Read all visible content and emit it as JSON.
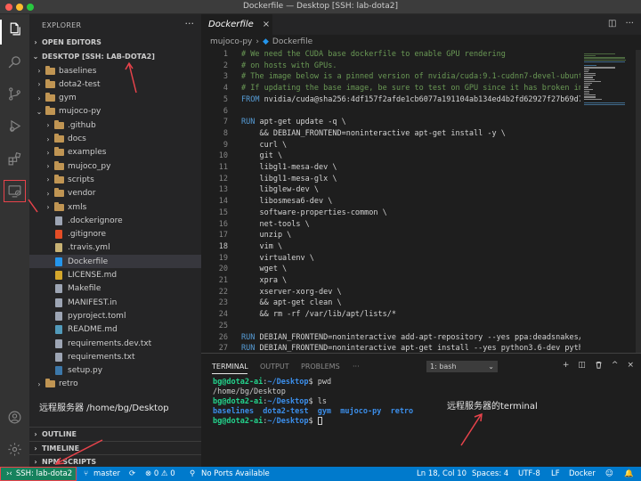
{
  "window": {
    "title": "Dockerfile — Desktop [SSH: lab-dota2]"
  },
  "explorer": {
    "header": "EXPLORER",
    "more": "···",
    "sections": {
      "open_editors": "OPEN EDITORS",
      "workspace": "DESKTOP [SSH: LAB-DOTA2]",
      "outline": "OUTLINE",
      "timeline": "TIMELINE",
      "npm_scripts": "NPM SCRIPTS"
    },
    "items": [
      {
        "label": "baselines",
        "kind": "folder",
        "depth": 1,
        "chevron": "›"
      },
      {
        "label": "dota2-test",
        "kind": "folder",
        "depth": 1,
        "chevron": "›"
      },
      {
        "label": "gym",
        "kind": "folder",
        "depth": 1,
        "chevron": "›"
      },
      {
        "label": "mujoco-py",
        "kind": "folder",
        "depth": 1,
        "chevron": "⌄"
      },
      {
        "label": ".github",
        "kind": "folder",
        "depth": 2,
        "chevron": "›"
      },
      {
        "label": "docs",
        "kind": "folder",
        "depth": 2,
        "chevron": "›"
      },
      {
        "label": "examples",
        "kind": "folder",
        "depth": 2,
        "chevron": "›"
      },
      {
        "label": "mujoco_py",
        "kind": "folder",
        "depth": 2,
        "chevron": "›"
      },
      {
        "label": "scripts",
        "kind": "folder",
        "depth": 2,
        "chevron": "›"
      },
      {
        "label": "vendor",
        "kind": "folder",
        "depth": 2,
        "chevron": "›"
      },
      {
        "label": "xmls",
        "kind": "folder",
        "depth": 2,
        "chevron": "›"
      },
      {
        "label": ".dockerignore",
        "kind": "file",
        "depth": 2,
        "color": "#9da5b4"
      },
      {
        "label": ".gitignore",
        "kind": "file",
        "depth": 2,
        "color": "#e44d26"
      },
      {
        "label": ".travis.yml",
        "kind": "file",
        "depth": 2,
        "color": "#c8b274"
      },
      {
        "label": "Dockerfile",
        "kind": "file",
        "depth": 2,
        "color": "#2496ed",
        "selected": true
      },
      {
        "label": "LICENSE.md",
        "kind": "file",
        "depth": 2,
        "color": "#d4a72c"
      },
      {
        "label": "Makefile",
        "kind": "file",
        "depth": 2,
        "color": "#9da5b4"
      },
      {
        "label": "MANIFEST.in",
        "kind": "file",
        "depth": 2,
        "color": "#9da5b4"
      },
      {
        "label": "pyproject.toml",
        "kind": "file",
        "depth": 2,
        "color": "#9da5b4"
      },
      {
        "label": "README.md",
        "kind": "file",
        "depth": 2,
        "color": "#519aba"
      },
      {
        "label": "requirements.dev.txt",
        "kind": "file",
        "depth": 2,
        "color": "#9da5b4"
      },
      {
        "label": "requirements.txt",
        "kind": "file",
        "depth": 2,
        "color": "#9da5b4"
      },
      {
        "label": "setup.py",
        "kind": "file",
        "depth": 2,
        "color": "#3c78aa"
      },
      {
        "label": "retro",
        "kind": "folder",
        "depth": 1,
        "chevron": "›"
      }
    ]
  },
  "annotations": {
    "remote_path": "远程服务器 /home/bg/Desktop",
    "remote_terminal": "远程服务器的terminal"
  },
  "editor": {
    "tab_label": "Dockerfile",
    "tab_close": "×",
    "breadcrumb": {
      "folder": "mujoco-py",
      "file": "Dockerfile",
      "separator": "›"
    },
    "lines": [
      {
        "n": "1",
        "segs": [
          {
            "t": "# We need the CUDA base dockerfile to enable GPU rendering",
            "c": "#6a9955"
          }
        ]
      },
      {
        "n": "2",
        "segs": [
          {
            "t": "# on hosts with GPUs.",
            "c": "#6a9955"
          }
        ]
      },
      {
        "n": "3",
        "segs": [
          {
            "t": "# The image below is a pinned version of nvidia/cuda:9.1-cudnn7-devel-ubuntu1",
            "c": "#6a9955"
          }
        ]
      },
      {
        "n": "4",
        "segs": [
          {
            "t": "# If updating the base image, be sure to test on GPU since it has broken in th",
            "c": "#6a9955"
          }
        ]
      },
      {
        "n": "5",
        "segs": [
          {
            "t": "FROM ",
            "c": "#569cd6"
          },
          {
            "t": "nvidia/cuda@sha256:4df157f2afde1cb6077a191104ab134ed4b2fd62927f27b69d788",
            "c": "#d4d4d4"
          }
        ]
      },
      {
        "n": "6",
        "segs": []
      },
      {
        "n": "7",
        "segs": [
          {
            "t": "RUN ",
            "c": "#569cd6"
          },
          {
            "t": "apt-get update -q \\",
            "c": "#d4d4d4"
          }
        ]
      },
      {
        "n": "8",
        "segs": [
          {
            "t": "    && DEBIAN_FRONTEND=noninteractive apt-get install -y \\",
            "c": "#d4d4d4"
          }
        ]
      },
      {
        "n": "9",
        "segs": [
          {
            "t": "    curl \\",
            "c": "#d4d4d4"
          }
        ]
      },
      {
        "n": "10",
        "segs": [
          {
            "t": "    git \\",
            "c": "#d4d4d4"
          }
        ]
      },
      {
        "n": "11",
        "segs": [
          {
            "t": "    libgl1-mesa-dev \\",
            "c": "#d4d4d4"
          }
        ]
      },
      {
        "n": "12",
        "segs": [
          {
            "t": "    libgl1-mesa-glx \\",
            "c": "#d4d4d4"
          }
        ]
      },
      {
        "n": "13",
        "segs": [
          {
            "t": "    libglew-dev \\",
            "c": "#d4d4d4"
          }
        ]
      },
      {
        "n": "14",
        "segs": [
          {
            "t": "    libosmesa6-dev \\",
            "c": "#d4d4d4"
          }
        ]
      },
      {
        "n": "15",
        "segs": [
          {
            "t": "    software-properties-common \\",
            "c": "#d4d4d4"
          }
        ]
      },
      {
        "n": "16",
        "segs": [
          {
            "t": "    net-tools \\",
            "c": "#d4d4d4"
          }
        ]
      },
      {
        "n": "17",
        "segs": [
          {
            "t": "    unzip \\",
            "c": "#d4d4d4"
          }
        ]
      },
      {
        "n": "18",
        "segs": [
          {
            "t": "    vim \\",
            "c": "#d4d4d4"
          }
        ],
        "current": true
      },
      {
        "n": "19",
        "segs": [
          {
            "t": "    virtualenv \\",
            "c": "#d4d4d4"
          }
        ]
      },
      {
        "n": "20",
        "segs": [
          {
            "t": "    wget \\",
            "c": "#d4d4d4"
          }
        ]
      },
      {
        "n": "21",
        "segs": [
          {
            "t": "    xpra \\",
            "c": "#d4d4d4"
          }
        ]
      },
      {
        "n": "22",
        "segs": [
          {
            "t": "    xserver-xorg-dev \\",
            "c": "#d4d4d4"
          }
        ]
      },
      {
        "n": "23",
        "segs": [
          {
            "t": "    && apt-get clean \\",
            "c": "#d4d4d4"
          }
        ]
      },
      {
        "n": "24",
        "segs": [
          {
            "t": "    && rm -rf /var/lib/apt/lists/*",
            "c": "#d4d4d4"
          }
        ]
      },
      {
        "n": "25",
        "segs": []
      },
      {
        "n": "26",
        "segs": [
          {
            "t": "RUN ",
            "c": "#569cd6"
          },
          {
            "t": "DEBIAN_FRONTEND=noninteractive add-apt-repository --yes ppa:deadsnakes/p",
            "c": "#d4d4d4"
          }
        ]
      },
      {
        "n": "27",
        "segs": [
          {
            "t": "RUN ",
            "c": "#569cd6"
          },
          {
            "t": "DEBIAN_FRONTEND=noninteractive apt-get install --yes python3.6-dev pytho",
            "c": "#d4d4d4"
          }
        ]
      }
    ]
  },
  "panel": {
    "tabs": [
      "TERMINAL",
      "OUTPUT",
      "PROBLEMS"
    ],
    "more": "···",
    "terminal_select": "1: bash",
    "select_caret": "⌄",
    "icons": {
      "add": "+",
      "split": "◫",
      "trash": "🗑",
      "maximize": "^",
      "close": "×"
    },
    "lines": [
      [
        {
          "t": "bg@dota2-ai",
          "c": "#23d18b",
          "b": true
        },
        {
          "t": ":",
          "c": "#cccccc"
        },
        {
          "t": "~/Desktop",
          "c": "#3b8eea",
          "b": true
        },
        {
          "t": "$ pwd",
          "c": "#cccccc"
        }
      ],
      [
        {
          "t": "/home/bg/Desktop",
          "c": "#cccccc"
        }
      ],
      [
        {
          "t": "bg@dota2-ai",
          "c": "#23d18b",
          "b": true
        },
        {
          "t": ":",
          "c": "#cccccc"
        },
        {
          "t": "~/Desktop",
          "c": "#3b8eea",
          "b": true
        },
        {
          "t": "$ ls",
          "c": "#cccccc"
        }
      ],
      [
        {
          "t": "baselines  dota2-test  gym  mujoco-py  retro",
          "c": "#3b8eea",
          "b": true
        }
      ],
      [
        {
          "t": "bg@dota2-ai",
          "c": "#23d18b",
          "b": true
        },
        {
          "t": ":",
          "c": "#cccccc"
        },
        {
          "t": "~/Desktop",
          "c": "#3b8eea",
          "b": true
        },
        {
          "t": "$ ",
          "c": "#cccccc"
        }
      ]
    ]
  },
  "status": {
    "remote": "SSH: lab-dota2",
    "branch": "master",
    "problems": "⊗ 0 ⚠ 0",
    "ports": "No Ports Available",
    "position": "Ln 18, Col 10",
    "spaces": "Spaces: 4",
    "encoding": "UTF-8",
    "eol": "LF",
    "language": "Docker"
  }
}
